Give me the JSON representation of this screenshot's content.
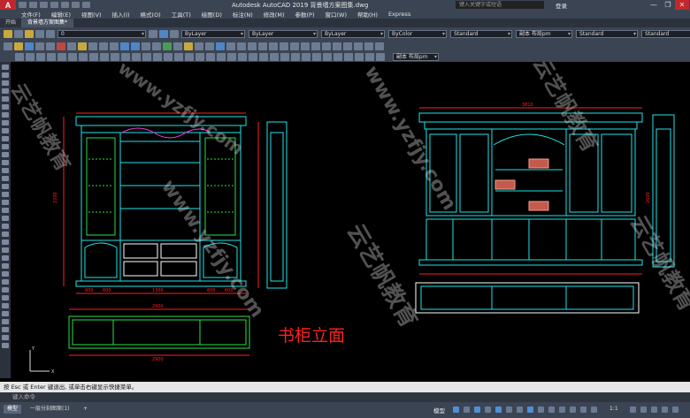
{
  "titlebar": {
    "app_logo": "A",
    "title": "Autodesk AutoCAD 2019   背景墙方案图集.dwg",
    "search_placeholder": "键入关键字或短语",
    "login": "登录",
    "minimize": "—",
    "restore": "❐",
    "close": "✕"
  },
  "menubar": [
    "文件(F)",
    "编辑(E)",
    "视图(V)",
    "插入(I)",
    "格式(O)",
    "工具(T)",
    "绘图(D)",
    "标注(N)",
    "修改(M)",
    "参数(P)",
    "窗口(W)",
    "帮助(H)",
    "Express"
  ],
  "tabs": [
    {
      "label": "开始",
      "active": false
    },
    {
      "label": "背景墙方案图集*",
      "active": true
    }
  ],
  "ribbon": {
    "layer_value": "0",
    "color_value": "ByLayer",
    "linetype_value": "ByLayer",
    "lineweight_value": "ByLayer",
    "plotstyle_value": "ByColor",
    "textstyle_value": "Standard",
    "dimstyle_value": "副本 布局pm",
    "tablestyle_value": "Standard",
    "mleaderstyle_value": "Standard",
    "layout_dim_value": "副本 布局pm"
  },
  "drawing": {
    "caption": "书柜立面",
    "dim_left_width": "2900",
    "dim_left_plan": "2900",
    "dim_right_width": "3810",
    "dim_left_height": "2200",
    "dim_right_height": "2600",
    "dim_bottom_parts": [
      "600",
      "600",
      "1300",
      "600",
      "600"
    ]
  },
  "watermarks": [
    "云艺帆教育",
    "www.yzfjy.com",
    "云艺帆教育",
    "www.yzfjy.com",
    "云艺帆教育",
    "云艺帆教育",
    "www.yzfjy.com"
  ],
  "command": {
    "history": "按 Esc 或 Enter 键退出, 或单击右键显示快捷菜单。",
    "input_placeholder": "键入命令"
  },
  "status": {
    "layout_tabs": [
      {
        "label": "模型",
        "active": true
      },
      {
        "label": "一层分刻图案(1)",
        "active": false
      },
      {
        "label": "+",
        "active": false
      }
    ],
    "model": "模型",
    "scale": "1:1"
  },
  "colors": {
    "cyan": "#21e3ea",
    "red": "#ff2020",
    "green": "#27e04a",
    "white": "#ffffff",
    "magenta": "#ff36e6",
    "ui_dark": "#3b4453"
  }
}
